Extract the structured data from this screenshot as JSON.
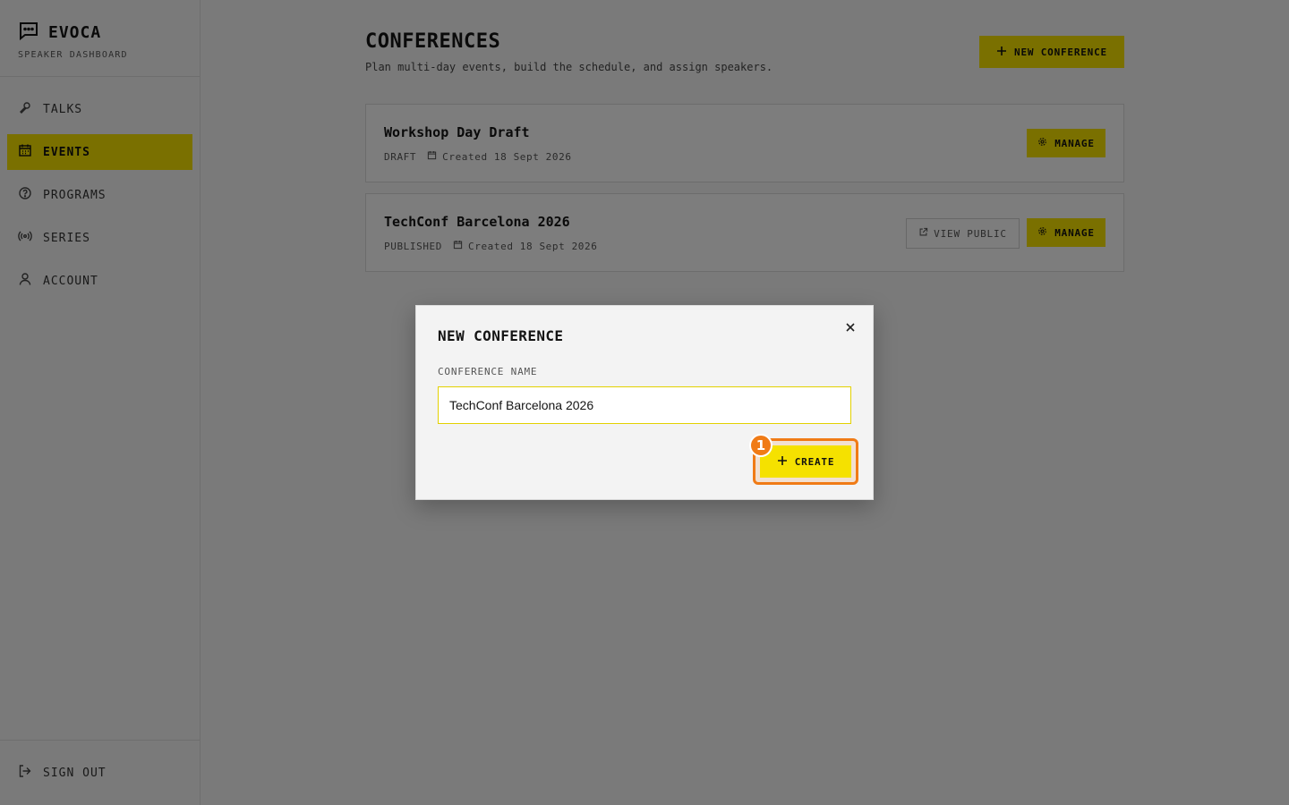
{
  "brand": {
    "name": "EVOCA",
    "subtitle": "SPEAKER DASHBOARD"
  },
  "nav": [
    {
      "label": "TALKS",
      "icon": "mic-icon",
      "active": false
    },
    {
      "label": "EVENTS",
      "icon": "calendar-icon",
      "active": true
    },
    {
      "label": "PROGRAMS",
      "icon": "help-circle-icon",
      "active": false
    },
    {
      "label": "SERIES",
      "icon": "broadcast-icon",
      "active": false
    },
    {
      "label": "ACCOUNT",
      "icon": "user-icon",
      "active": false
    }
  ],
  "sign_out": "SIGN OUT",
  "page": {
    "title": "CONFERENCES",
    "subtitle": "Plan multi-day events, build the schedule, and assign speakers.",
    "new_button": "NEW CONFERENCE"
  },
  "conferences": [
    {
      "name": "Workshop Day Draft",
      "status": "DRAFT",
      "created": "Created 18 Sept 2026",
      "manage": "MANAGE"
    },
    {
      "name": "TechConf Barcelona 2026",
      "status": "PUBLISHED",
      "created": "Created 18 Sept 2026",
      "view_public": "VIEW PUBLIC",
      "manage": "MANAGE"
    }
  ],
  "modal": {
    "title": "NEW CONFERENCE",
    "field_label": "CONFERENCE NAME",
    "field_value": "TechConf Barcelona 2026",
    "create_label": "CREATE",
    "annotation_badge": "1"
  },
  "colors": {
    "accent": "#f5e100",
    "highlight": "#f07b16",
    "overlay": "rgba(0,0,0,0.5)"
  }
}
